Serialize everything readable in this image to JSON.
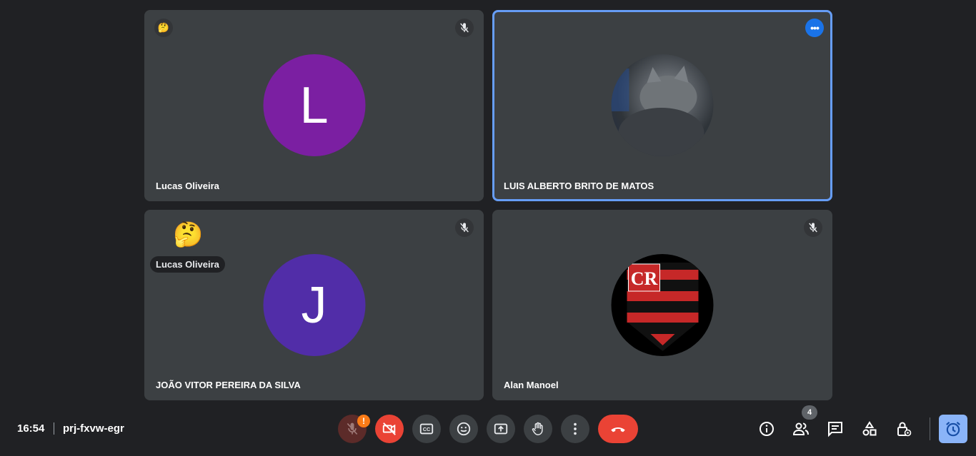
{
  "tiles": [
    {
      "name": "Lucas Oliveira",
      "initial": "L",
      "avatar_color": "#7b1fa2",
      "mic": "muted",
      "reaction": "🤔"
    },
    {
      "name": "LUIS ALBERTO BRITO DE MATOS",
      "avatar": "cat-photo",
      "active_speaker": true,
      "more_label": "•••"
    },
    {
      "name": "JOÃO VITOR PEREIRA DA SILVA",
      "initial": "J",
      "avatar_color": "#512da8",
      "mic": "muted",
      "reaction": "🤔",
      "reaction_sender": "Lucas Oliveira"
    },
    {
      "name": "Alan Manoel",
      "avatar": "flamengo-crest",
      "mic": "muted"
    }
  ],
  "bottom_bar": {
    "time": "16:54",
    "meeting_code": "prj-fxvw-egr",
    "mic_warning_badge": "!",
    "people_count": "4"
  },
  "colors": {
    "background": "#202124",
    "tile": "#3c4043",
    "active_border": "#669df6",
    "danger": "#ea4335",
    "accent": "#8ab4f8"
  }
}
